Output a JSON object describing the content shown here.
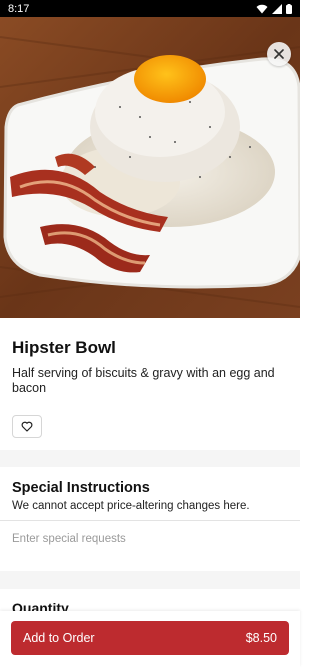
{
  "status_bar": {
    "time": "8:17"
  },
  "item": {
    "title": "Hipster Bowl",
    "description": "Half serving of biscuits & gravy with an egg and bacon"
  },
  "special_instructions": {
    "title": "Special Instructions",
    "subtitle": "We cannot accept price-altering changes here.",
    "placeholder": "Enter special requests"
  },
  "quantity": {
    "label": "Quantity"
  },
  "add_to_order": {
    "label": "Add to Order",
    "price": "$8.50"
  },
  "colors": {
    "accent": "#bd2b2f",
    "status_bar": "#000000",
    "section_gap": "#f5f5f5"
  },
  "icons": [
    "wifi-icon",
    "signal-icon",
    "battery-icon",
    "close-icon",
    "heart-icon"
  ]
}
